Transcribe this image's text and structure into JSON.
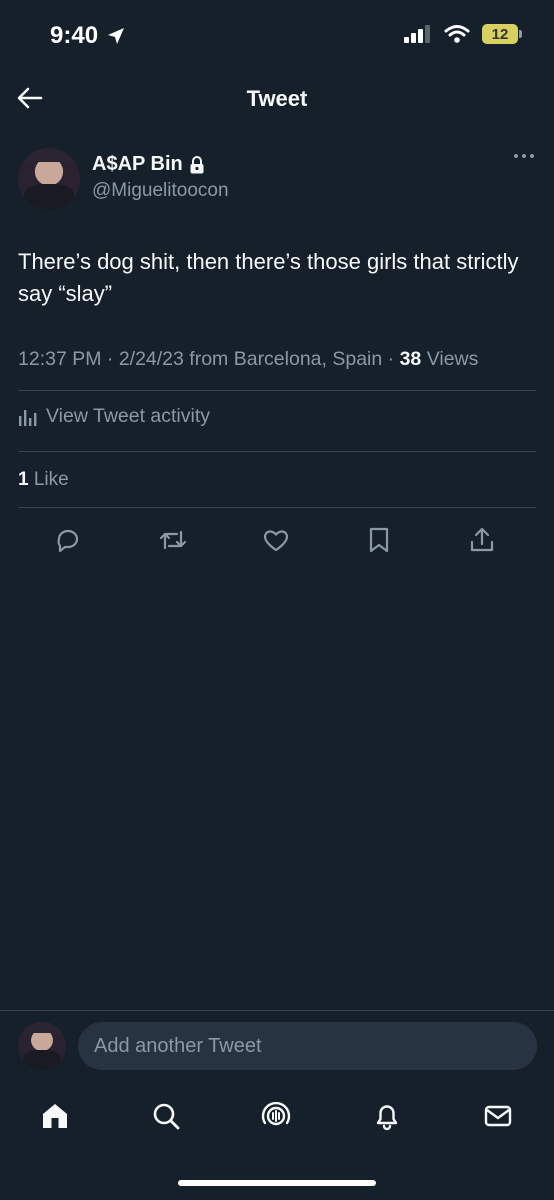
{
  "status_bar": {
    "time": "9:40",
    "battery": "12"
  },
  "header": {
    "title": "Tweet"
  },
  "author": {
    "name": "A$AP Bin",
    "handle": "@Miguelitoocon"
  },
  "tweet": {
    "text": "There’s dog shit, then there’s those girls that strictly say “slay”",
    "time": "12:37 PM",
    "date": "2/24/23",
    "location": "from Barcelona, Spain",
    "views_count": "38",
    "views_label": "Views"
  },
  "activity": {
    "label": "View Tweet activity"
  },
  "engagement": {
    "likes_count": "1",
    "likes_label": "Like"
  },
  "actions": [
    "reply-icon",
    "retweet-icon",
    "heart-icon",
    "bookmark-icon",
    "share-icon"
  ],
  "compose": {
    "placeholder": "Add another Tweet"
  },
  "bottom_nav": [
    "home-icon",
    "search-icon",
    "spaces-icon",
    "notifications-icon",
    "messages-icon"
  ],
  "colors": {
    "background": "#15202b",
    "text": "#f7f9f9",
    "secondary": "#8b98a5",
    "divider": "#38444d",
    "input_bg": "#273340"
  }
}
